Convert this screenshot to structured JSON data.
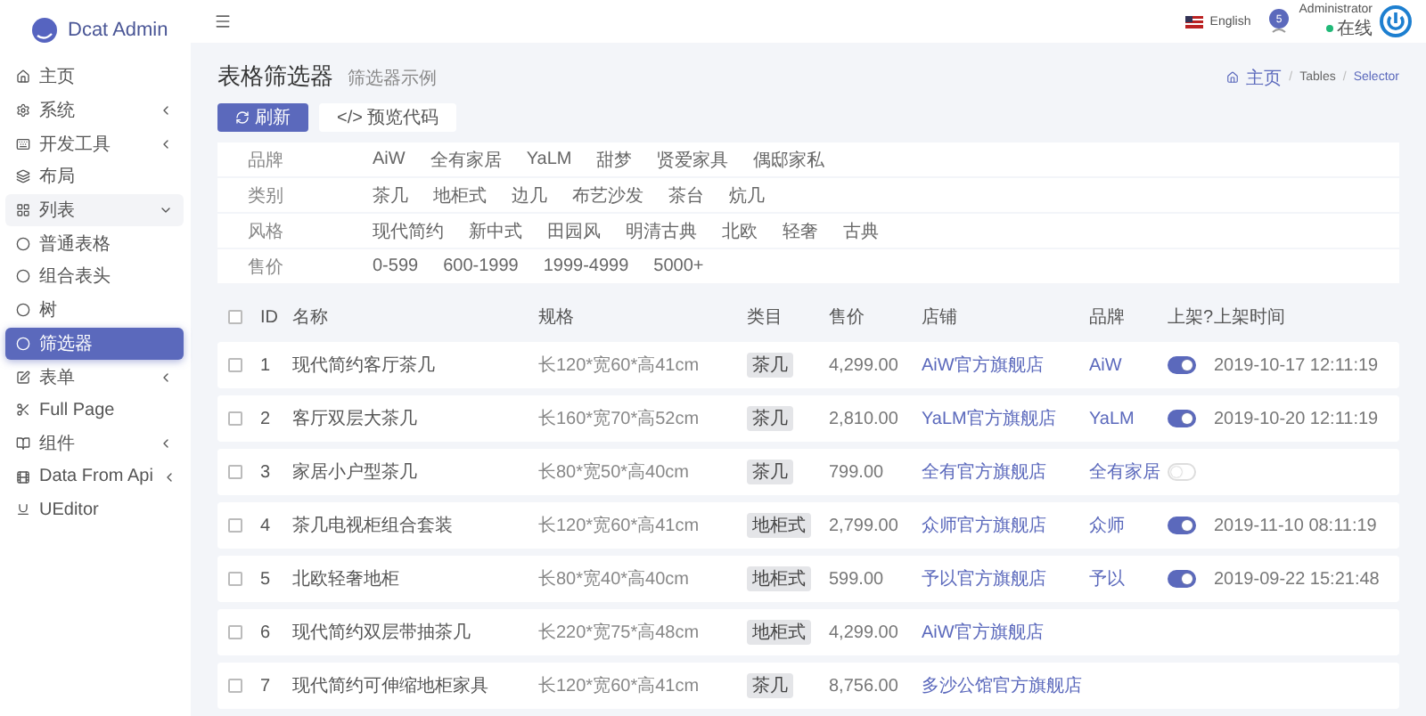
{
  "brand": {
    "name": "Dcat Admin"
  },
  "header": {
    "language": "English",
    "badge": "5",
    "user": "Administrator",
    "status": "在线"
  },
  "sidebar": {
    "items": [
      {
        "label": "主页",
        "selected": false
      },
      {
        "label": "系统",
        "selected": false,
        "expanded": false
      },
      {
        "label": "开发工具",
        "selected": false,
        "expanded": false
      },
      {
        "label": "布局",
        "selected": false
      },
      {
        "label": "列表",
        "selected": false,
        "expanded": true,
        "children": [
          {
            "label": "普通表格",
            "selected": false
          },
          {
            "label": "组合表头",
            "selected": false
          },
          {
            "label": "树",
            "selected": false
          },
          {
            "label": "筛选器",
            "selected": true
          }
        ]
      },
      {
        "label": "表单",
        "selected": false,
        "expanded": false
      },
      {
        "label": "Full Page",
        "selected": false
      },
      {
        "label": "组件",
        "selected": false,
        "expanded": false
      },
      {
        "label": "Data From Api",
        "selected": false,
        "expanded": false
      },
      {
        "label": "UEditor",
        "selected": false
      }
    ]
  },
  "page": {
    "title": "表格筛选器",
    "subtitle": "筛选器示例",
    "breadcrumb": [
      "主页",
      "Tables",
      "Selector"
    ],
    "separator": "/"
  },
  "toolbar": {
    "buttons": [
      {
        "kind": "primary",
        "label": "刷新"
      },
      {
        "kind": "plain",
        "label": "</> 预览代码"
      }
    ]
  },
  "filters": [
    {
      "label": "品牌",
      "options": [
        "AiW",
        "全有家居",
        "YaLM",
        "甜梦",
        "贤爱家具",
        "偶邸家私"
      ]
    },
    {
      "label": "类别",
      "options": [
        "茶几",
        "地柜式",
        "边几",
        "布艺沙发",
        "茶台",
        "炕几"
      ]
    },
    {
      "label": "风格",
      "options": [
        "现代简约",
        "新中式",
        "田园风",
        "明清古典",
        "北欧",
        "轻奢",
        "古典"
      ]
    },
    {
      "label": "售价",
      "options": [
        "0-599",
        "600-1999",
        "1999-4999",
        "5000+"
      ]
    }
  ],
  "table": {
    "select_all": {
      "checked": false
    },
    "columns": [
      "ID",
      "名称",
      "规格",
      "类目",
      "售价",
      "店铺",
      "品牌",
      "上架?",
      "上架时间"
    ],
    "rows": [
      {
        "checked": false,
        "id": "1",
        "name": "现代简约客厅茶几",
        "spec": "长120*宽60*高41cm",
        "category": "茶几",
        "price": "4,299.00",
        "store": "AiW官方旗舰店",
        "brand": "AiW",
        "on": true,
        "time": "2019-10-17 12:11:19"
      },
      {
        "checked": false,
        "id": "2",
        "name": "客厅双层大茶几",
        "spec": "长160*宽70*高52cm",
        "category": "茶几",
        "price": "2,810.00",
        "store": "YaLM官方旗舰店",
        "brand": "YaLM",
        "on": true,
        "time": "2019-10-20 12:11:19"
      },
      {
        "checked": false,
        "id": "3",
        "name": "家居小户型茶几",
        "spec": "长80*宽50*高40cm",
        "category": "茶几",
        "price": "799.00",
        "store": "全有官方旗舰店",
        "brand": "全有家居",
        "on": false
      },
      {
        "checked": false,
        "id": "4",
        "name": "茶几电视柜组合套装",
        "spec": "长120*宽60*高41cm",
        "category": "地柜式",
        "price": "2,799.00",
        "store": "众师官方旗舰店",
        "brand": "众师",
        "on": true,
        "time": "2019-11-10 08:11:19"
      },
      {
        "checked": false,
        "id": "5",
        "name": "北欧轻奢地柜",
        "spec": "长80*宽40*高40cm",
        "category": "地柜式",
        "price": "599.00",
        "store": "予以官方旗舰店",
        "brand": "予以",
        "on": true,
        "time": "2019-09-22 15:21:48"
      },
      {
        "checked": false,
        "id": "6",
        "name": "现代简约双层带抽茶几",
        "spec": "长220*宽75*高48cm",
        "category": "地柜式",
        "price": "4,299.00",
        "store": "AiW官方旗舰店"
      },
      {
        "checked": false,
        "id": "7",
        "name": "现代简约可伸缩地柜家具",
        "spec": "长120*宽60*高41cm",
        "category": "茶几",
        "price": "8,756.00",
        "store": "多沙公馆官方旗舰店"
      }
    ]
  }
}
